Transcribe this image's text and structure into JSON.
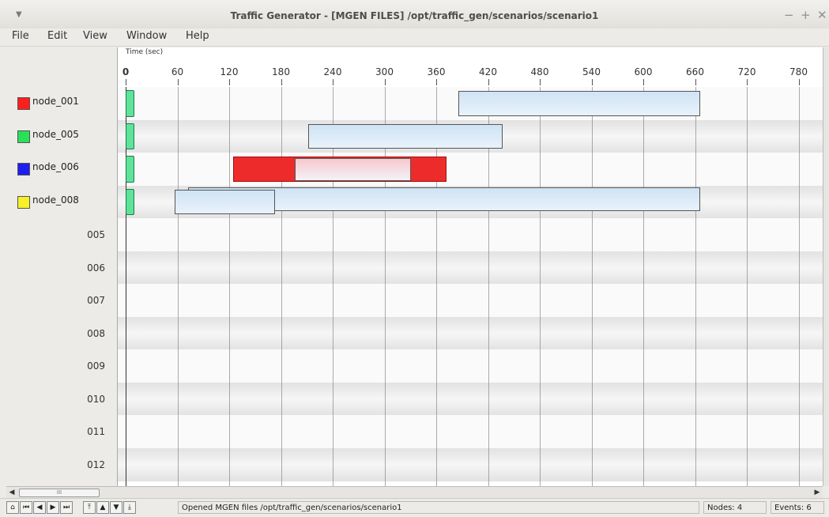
{
  "window": {
    "title": "Traffic Generator - [MGEN FILES] /opt/traffic_gen/scenarios/scenario1",
    "controls": [
      "−",
      "+",
      "✕"
    ]
  },
  "menu": [
    "File",
    "Edit",
    "View",
    "Window",
    "Help"
  ],
  "timeline": {
    "axis_label": "Time (sec)",
    "ticks": [
      "0",
      "60",
      "120",
      "180",
      "240",
      "300",
      "360",
      "420",
      "480",
      "540",
      "600",
      "660",
      "720",
      "780"
    ]
  },
  "nodes": [
    {
      "name": "node_001",
      "color": "#ff1e1e"
    },
    {
      "name": "node_005",
      "color": "#28e05a"
    },
    {
      "name": "node_006",
      "color": "#1e1ef0"
    },
    {
      "name": "node_008",
      "color": "#f5f028"
    }
  ],
  "row_labels": [
    "005",
    "006",
    "007",
    "008",
    "009",
    "010",
    "011",
    "012"
  ],
  "events": [
    {
      "row": 0,
      "start": 0,
      "end": 10,
      "style": "mark"
    },
    {
      "row": 1,
      "start": 0,
      "end": 10,
      "style": "mark"
    },
    {
      "row": 2,
      "start": 0,
      "end": 10,
      "style": "mark"
    },
    {
      "row": 3,
      "start": 0,
      "end": 10,
      "style": "mark"
    },
    {
      "row": 0,
      "start": 386,
      "end": 666,
      "style": "blue"
    },
    {
      "row": 1,
      "start": 212,
      "end": 437,
      "style": "blue"
    },
    {
      "row": 2,
      "start": 125,
      "end": 372,
      "style": "red"
    },
    {
      "row": 2,
      "start": 196,
      "end": 331,
      "style": "pink"
    },
    {
      "row": 3,
      "start": 72,
      "end": 666,
      "style": "blue"
    },
    {
      "row": 3,
      "start": 57,
      "end": 173,
      "style": "blue"
    }
  ],
  "statusbar": {
    "nav_buttons": [
      "⌂",
      "⏮",
      "◀",
      "▶",
      "⏭"
    ],
    "nav_buttons_2": [
      "⤒",
      "▲",
      "▼",
      "⤓"
    ],
    "message": "Opened MGEN files /opt/traffic_gen/scenarios/scenario1",
    "nodes": "Nodes: 4",
    "events": "Events: 6"
  },
  "scroll": {
    "thumb_label": "III",
    "left_arrow": "◀",
    "right_arrow": "▶"
  }
}
